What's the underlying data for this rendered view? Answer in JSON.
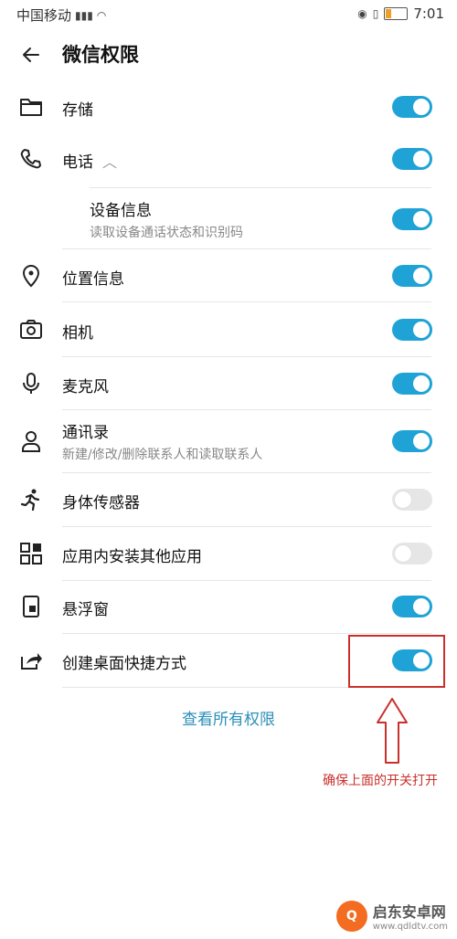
{
  "status": {
    "carrier": "中国移动",
    "time": "7:01",
    "battery_fraction": 0.25
  },
  "header": {
    "title": "微信权限"
  },
  "permissions": [
    {
      "label": "存储",
      "icon": "folder-icon",
      "on": true
    },
    {
      "label": "电话",
      "icon": "phone-icon",
      "on": true,
      "expandable": true
    },
    {
      "label": "设备信息",
      "sub": "读取设备通话状态和识别码",
      "on": true,
      "indent": true
    },
    {
      "label": "位置信息",
      "icon": "location-icon",
      "on": true
    },
    {
      "label": "相机",
      "icon": "camera-icon",
      "on": true
    },
    {
      "label": "麦克风",
      "icon": "microphone-icon",
      "on": true
    },
    {
      "label": "通讯录",
      "sub": "新建/修改/删除联系人和读取联系人",
      "icon": "contacts-icon",
      "on": true
    },
    {
      "label": "身体传感器",
      "icon": "running-icon",
      "on": false
    },
    {
      "label": "应用内安装其他应用",
      "icon": "apps-icon",
      "on": false
    },
    {
      "label": "悬浮窗",
      "icon": "floating-window-icon",
      "on": true
    },
    {
      "label": "创建桌面快捷方式",
      "icon": "shortcut-icon",
      "on": true
    }
  ],
  "view_all": "查看所有权限",
  "annotation": {
    "note": "确保上面的开关打开"
  },
  "watermark": {
    "name": "启东安卓网",
    "url": "www.qdldtv.com"
  },
  "colors": {
    "accent": "#1fa3d6",
    "annotation": "#c9302c"
  }
}
